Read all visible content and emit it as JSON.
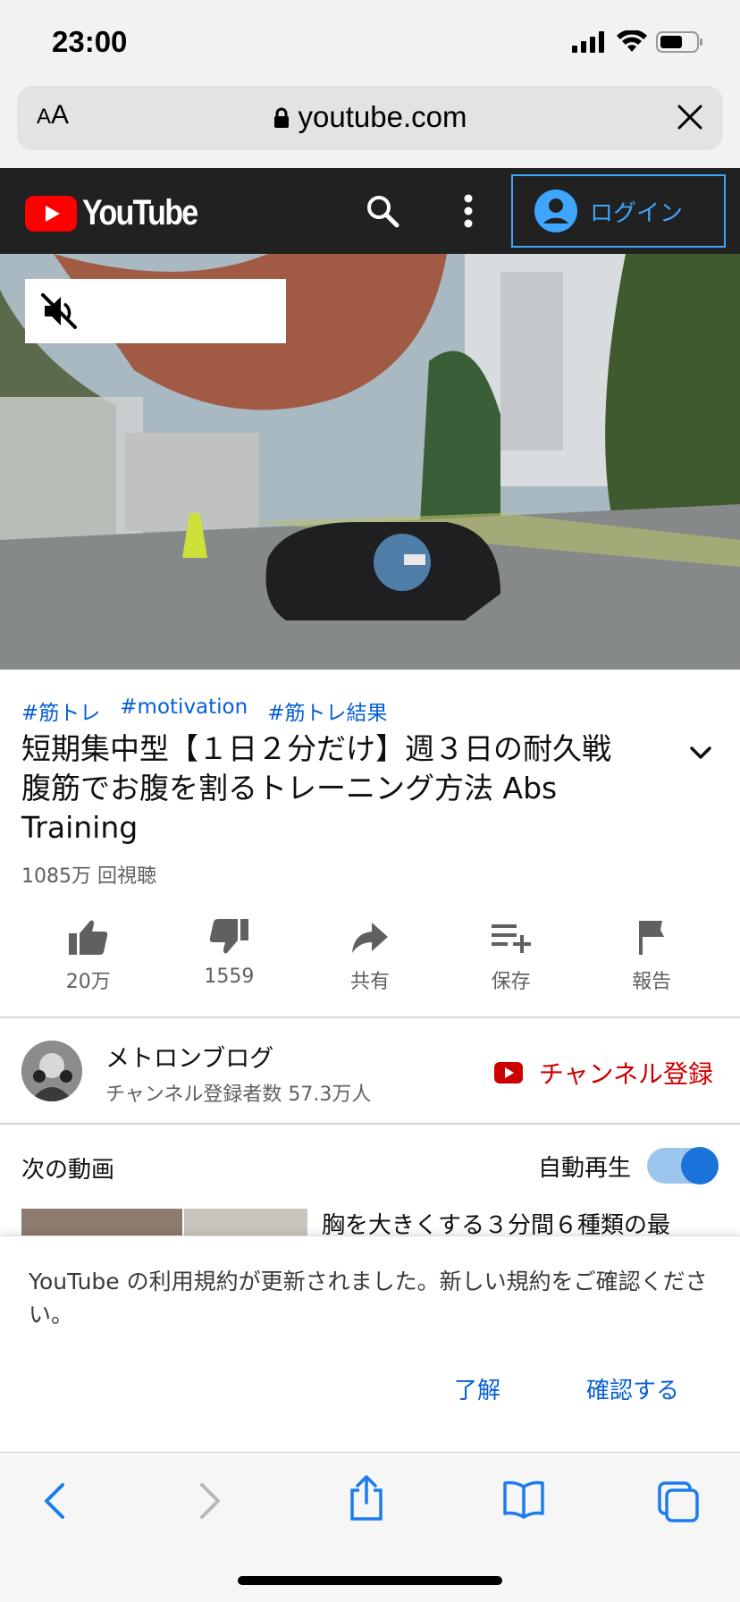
{
  "status_bar": {
    "time": "23:00"
  },
  "safari": {
    "aa_label_small": "A",
    "aa_label": "A",
    "url": "youtube.com"
  },
  "youtube_header": {
    "logo_text": "YouTube",
    "login_label": "ログイン"
  },
  "video": {
    "muted": true
  },
  "hashtags": [
    "#筋トレ",
    "#motivation",
    "#筋トレ結果"
  ],
  "title": {
    "line1": "短期集中型【１日２分だけ】週３日の耐久戦",
    "line2": "腹筋でお腹を割るトレーニング方法 Abs",
    "line3": "Training"
  },
  "views": "1085万 回視聴",
  "actions": [
    {
      "label": "20万",
      "icon": "thumbs-up-icon"
    },
    {
      "label": "1559",
      "icon": "thumbs-down-icon"
    },
    {
      "label": "共有",
      "icon": "share-icon"
    },
    {
      "label": "保存",
      "icon": "playlist-add-icon"
    },
    {
      "label": "報告",
      "icon": "flag-icon"
    }
  ],
  "channel": {
    "name": "メトロンブログ",
    "subscribers": "チャンネル登録者数 57.3万人",
    "subscribe_label": "チャンネル登録"
  },
  "up_next": {
    "title": "次の動画",
    "autoplay_label": "自動再生",
    "autoplay_on": true,
    "next_video_title": "胸を大きくする３分間６種類の最"
  },
  "terms_sheet": {
    "message": "YouTube の利用規約が更新されました。新しい規約をご確認ください。",
    "ok_label": "了解",
    "review_label": "確認する"
  },
  "colors": {
    "yt_red": "#ff0000",
    "link_blue": "#065fd4",
    "login_blue": "#3ea6ff",
    "subscribe_red": "#cc0000",
    "safari_blue": "#1b7cf2"
  }
}
